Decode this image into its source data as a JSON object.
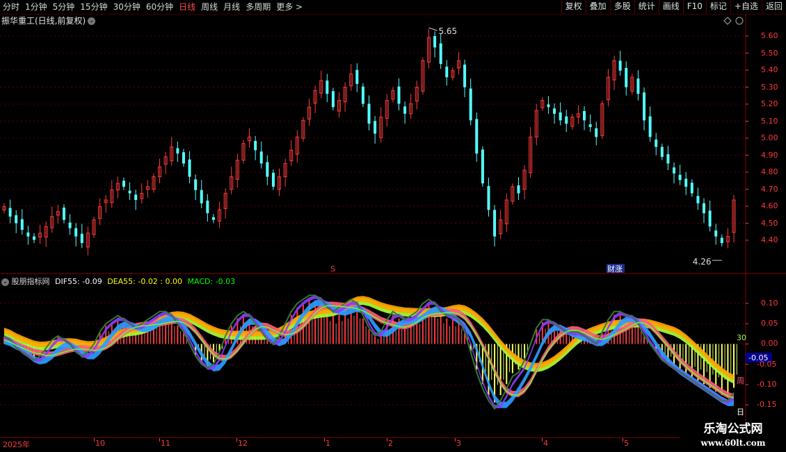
{
  "toolbar": {
    "periods": [
      "分时",
      "1分钟",
      "5分钟",
      "15分钟",
      "30分钟",
      "60分钟",
      "日线",
      "周线",
      "月线",
      "多周期",
      "更多 >"
    ],
    "active_period": "日线",
    "right_buttons": [
      "复权",
      "叠加",
      "多股",
      "统计",
      "画线",
      "F10",
      "标记",
      "+自选",
      "返回"
    ]
  },
  "stock": {
    "title": "振华重工(日线,前复权)",
    "high_label": "5.65",
    "low_label": "4.26",
    "marker_s": "S",
    "marker_finance": "财涨"
  },
  "price_axis": [
    "5.60",
    "5.50",
    "5.40",
    "5.30",
    "5.20",
    "5.10",
    "5.00",
    "4.90",
    "4.80",
    "4.70",
    "4.60",
    "4.50",
    "4.40"
  ],
  "indicator": {
    "name": "股朋指标网",
    "dif_label": "DIF55: -0.09",
    "dea_label": "DEA55: -0.02 : 0.00",
    "macd_label": "MACD: -0.03",
    "axis": [
      "0.10",
      "0.05",
      "0.00",
      "-0.05",
      "-0.10",
      "-0.15"
    ],
    "current_value": "-0.05",
    "tag_30": "30",
    "tag_week": "周",
    "tag_day": "日"
  },
  "dates": {
    "year": "2025年",
    "months": [
      "10",
      "11",
      "12",
      "1",
      "2",
      "3",
      "4",
      "5"
    ]
  },
  "watermark": {
    "line1": "乐淘公式网",
    "line2": "www.60lt.com"
  },
  "colors": {
    "up": "#ff3b3b",
    "down": "#54ffff",
    "accent": "#ff3b3b",
    "dif": "#ffffff",
    "dea": "#ffff00",
    "macd": "#00ff00"
  },
  "chart_data": {
    "type": "candlestick",
    "price_ylim": [
      4.26,
      5.65
    ],
    "close_series": [
      4.58,
      4.52,
      4.48,
      4.44,
      4.4,
      4.38,
      4.42,
      4.46,
      4.52,
      4.55,
      4.5,
      4.45,
      4.4,
      4.36,
      4.42,
      4.5,
      4.58,
      4.62,
      4.68,
      4.72,
      4.7,
      4.66,
      4.62,
      4.66,
      4.7,
      4.76,
      4.82,
      4.88,
      4.94,
      4.9,
      4.84,
      4.76,
      4.68,
      4.6,
      4.54,
      4.5,
      4.56,
      4.66,
      4.76,
      4.86,
      4.96,
      5.0,
      4.92,
      4.84,
      4.76,
      4.7,
      4.76,
      4.84,
      4.92,
      5.0,
      5.1,
      5.18,
      5.28,
      5.34,
      5.26,
      5.18,
      5.22,
      5.3,
      5.38,
      5.32,
      5.2,
      5.08,
      5.02,
      5.12,
      5.22,
      5.28,
      5.2,
      5.14,
      5.2,
      5.3,
      5.46,
      5.6,
      5.54,
      5.44,
      5.36,
      5.4,
      5.46,
      5.3,
      5.1,
      4.9,
      4.72,
      4.56,
      4.4,
      4.5,
      4.62,
      4.7,
      4.66,
      4.8,
      5.0,
      5.16,
      5.22,
      5.18,
      5.14,
      5.1,
      5.08,
      5.12,
      5.14,
      5.1,
      5.06,
      5.0,
      5.2,
      5.36,
      5.46,
      5.4,
      5.3,
      5.36,
      5.26,
      5.1,
      5.0,
      4.94,
      4.88,
      4.84,
      4.78,
      4.74,
      4.7,
      4.66,
      4.6,
      4.54,
      4.46,
      4.4,
      4.36,
      4.4,
      4.62
    ],
    "macd_ylim": [
      -0.17,
      0.14
    ],
    "dif_series": [
      0.02,
      0.01,
      -0.01,
      -0.02,
      -0.03,
      -0.04,
      -0.03,
      -0.01,
      0.01,
      0.02,
      0.01,
      0.0,
      -0.02,
      -0.03,
      -0.02,
      0.0,
      0.03,
      0.05,
      0.06,
      0.07,
      0.06,
      0.05,
      0.04,
      0.05,
      0.06,
      0.07,
      0.08,
      0.08,
      0.07,
      0.05,
      0.03,
      0.0,
      -0.03,
      -0.05,
      -0.06,
      -0.05,
      -0.02,
      0.02,
      0.05,
      0.07,
      0.08,
      0.07,
      0.05,
      0.03,
      0.01,
      0.0,
      0.02,
      0.05,
      0.08,
      0.1,
      0.11,
      0.12,
      0.12,
      0.11,
      0.09,
      0.08,
      0.09,
      0.1,
      0.11,
      0.1,
      0.07,
      0.04,
      0.02,
      0.03,
      0.06,
      0.08,
      0.07,
      0.06,
      0.07,
      0.08,
      0.1,
      0.11,
      0.1,
      0.08,
      0.07,
      0.07,
      0.06,
      0.03,
      -0.02,
      -0.07,
      -0.11,
      -0.14,
      -0.16,
      -0.14,
      -0.11,
      -0.08,
      -0.07,
      -0.04,
      0.0,
      0.04,
      0.06,
      0.06,
      0.05,
      0.04,
      0.03,
      0.03,
      0.03,
      0.02,
      0.01,
      0.0,
      0.03,
      0.06,
      0.08,
      0.08,
      0.07,
      0.07,
      0.05,
      0.02,
      0.0,
      -0.02,
      -0.04,
      -0.05,
      -0.06,
      -0.07,
      -0.08,
      -0.09,
      -0.1,
      -0.11,
      -0.12,
      -0.13,
      -0.14,
      -0.14,
      -0.12
    ]
  }
}
